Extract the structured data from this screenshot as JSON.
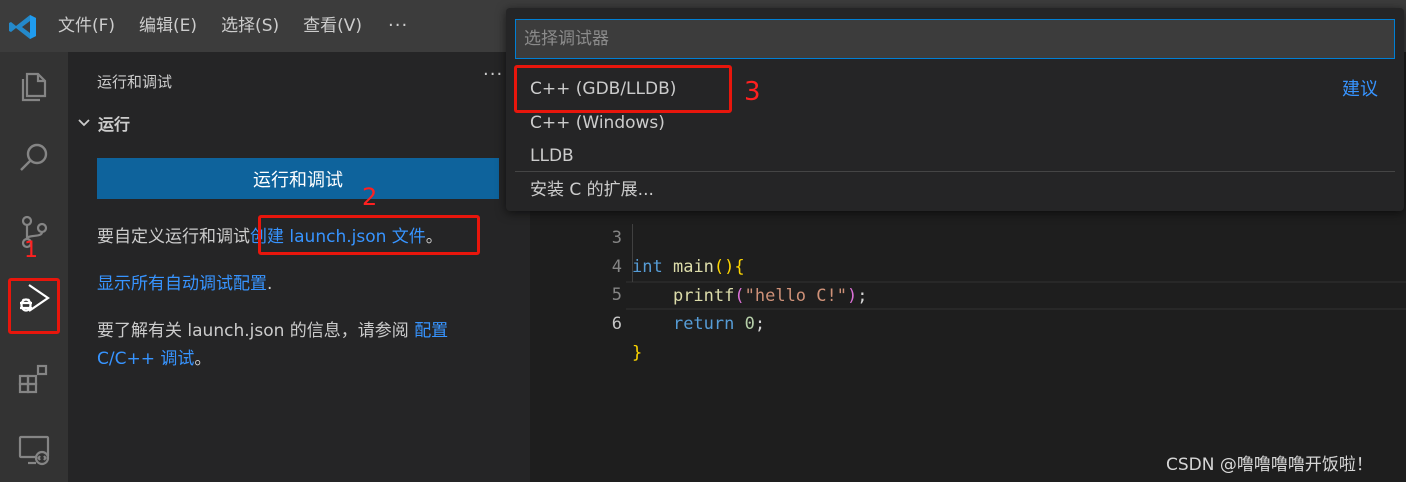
{
  "menubar": {
    "items": [
      "文件(F)",
      "编辑(E)",
      "选择(S)",
      "查看(V)"
    ],
    "more": "···"
  },
  "activitybar": {
    "icons": [
      "explorer-icon",
      "search-icon",
      "source-control-icon",
      "run-debug-icon",
      "extensions-icon",
      "remote-explorer-icon"
    ],
    "annotation": "1"
  },
  "sidebar": {
    "title": "运行和调试",
    "more": "···",
    "section_title": "运行",
    "run_button": "运行和调试",
    "line1_prefix": "要自定义运行和调试",
    "line1_link": "创建 launch.json 文件",
    "line1_suffix": "。",
    "line2_link": "显示所有自动调试配置",
    "line2_suffix": ".",
    "line3_prefix": "要了解有关 launch.json 的信息，请参阅 ",
    "line3_link": "配置 C/C++ 调试",
    "line3_suffix": "。",
    "annotation": "2"
  },
  "editor": {
    "lines": [
      {
        "num": "3",
        "text": "int main(){"
      },
      {
        "num": "4",
        "text": "    printf(\"hello C!\");"
      },
      {
        "num": "5",
        "text": "    return 0;"
      },
      {
        "num": "6",
        "text": "}"
      }
    ],
    "watermark": "CSDN @噜噜噜噜开饭啦！"
  },
  "quickpick": {
    "placeholder": "选择调试器",
    "items": [
      {
        "label": "C++ (GDB/LLDB)",
        "hint": "建议"
      },
      {
        "label": "C++ (Windows)",
        "hint": ""
      },
      {
        "label": "LLDB",
        "hint": ""
      },
      {
        "label": "安装 C 的扩展...",
        "hint": ""
      }
    ],
    "annotation": "3"
  },
  "colors": {
    "accent": "#0e639c",
    "link": "#3794ff",
    "annotation_red": "#e8160c"
  }
}
